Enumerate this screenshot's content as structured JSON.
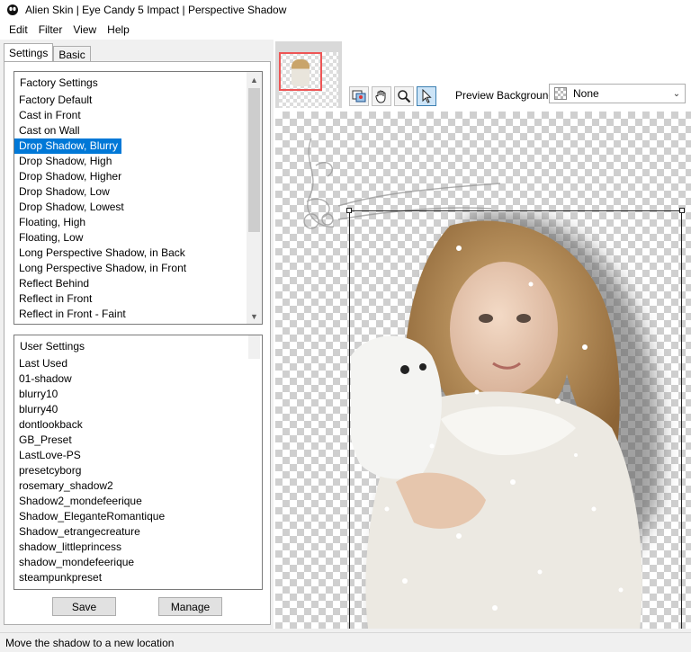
{
  "window": {
    "title": "Alien Skin | Eye Candy 5 Impact | Perspective Shadow",
    "icon": "alien-skin-icon"
  },
  "menu": {
    "items": [
      "Edit",
      "Filter",
      "View",
      "Help"
    ]
  },
  "tabs": [
    {
      "label": "Settings",
      "active": true
    },
    {
      "label": "Basic",
      "active": false
    }
  ],
  "factory_settings": {
    "header": "Factory Settings",
    "selected": "Drop Shadow, Blurry",
    "items": [
      "Factory Default",
      "Cast in Front",
      "Cast on Wall",
      "Drop Shadow, Blurry",
      "Drop Shadow, High",
      "Drop Shadow, Higher",
      "Drop Shadow, Low",
      "Drop Shadow, Lowest",
      "Floating, High",
      "Floating, Low",
      "Long Perspective Shadow, in Back",
      "Long Perspective Shadow, in Front",
      "Reflect Behind",
      "Reflect in Front",
      "Reflect in Front - Faint"
    ]
  },
  "user_settings": {
    "header": "User Settings",
    "items": [
      "Last Used",
      "01-shadow",
      "blurry10",
      "blurry40",
      "dontlookback",
      "GB_Preset",
      "LastLove-PS",
      "presetcyborg",
      "rosemary_shadow2",
      "Shadow2_mondefeerique",
      "Shadow_EleganteRomantique",
      "Shadow_etrangecreature",
      "shadow_littleprincess",
      "shadow_mondefeerique",
      "steampunkpreset"
    ]
  },
  "buttons": {
    "save": "Save",
    "manage": "Manage"
  },
  "preview_toolbar": {
    "tools": [
      "navigator-icon",
      "hand-pan-icon",
      "zoom-magnifier-icon",
      "pointer-arrow-icon"
    ],
    "active_tool": "pointer-arrow-icon",
    "background_label": "Preview Background:",
    "background_value": "None"
  },
  "status": {
    "text": "Move the shadow to a new location"
  },
  "colors": {
    "selection": "#0078d7",
    "navigator_rect": "#e55555"
  }
}
